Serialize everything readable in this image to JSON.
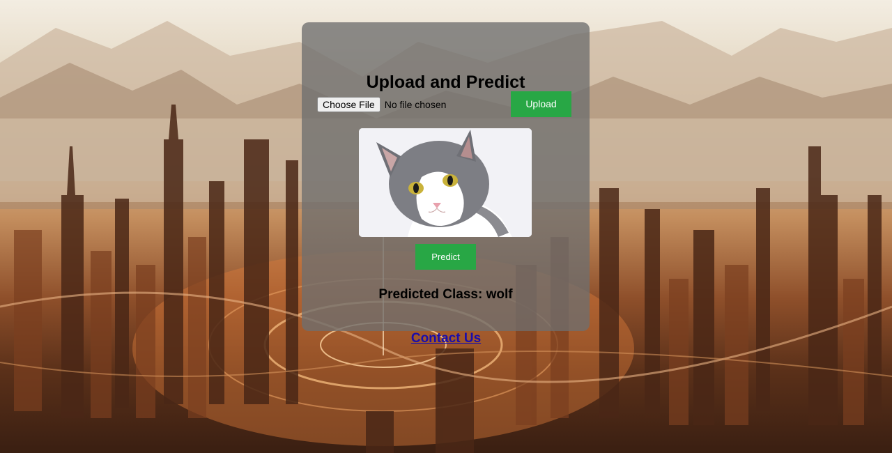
{
  "page": {
    "title": "Upload and Predict",
    "background_theme": "futuristic-city-mountains"
  },
  "upload_form": {
    "choose_file_label": "Choose File",
    "file_status": "No file chosen",
    "upload_label": "Upload"
  },
  "preview": {
    "image_subject": "grey-and-white-cat",
    "alt": "cat"
  },
  "predict": {
    "label": "Predict"
  },
  "result": {
    "text": "Predicted Class: wolf"
  },
  "footer": {
    "contact_label": "Contact Us"
  },
  "colors": {
    "accent_green": "#28a745",
    "card_bg": "#6e6e6e",
    "link": "#1a0dab"
  }
}
